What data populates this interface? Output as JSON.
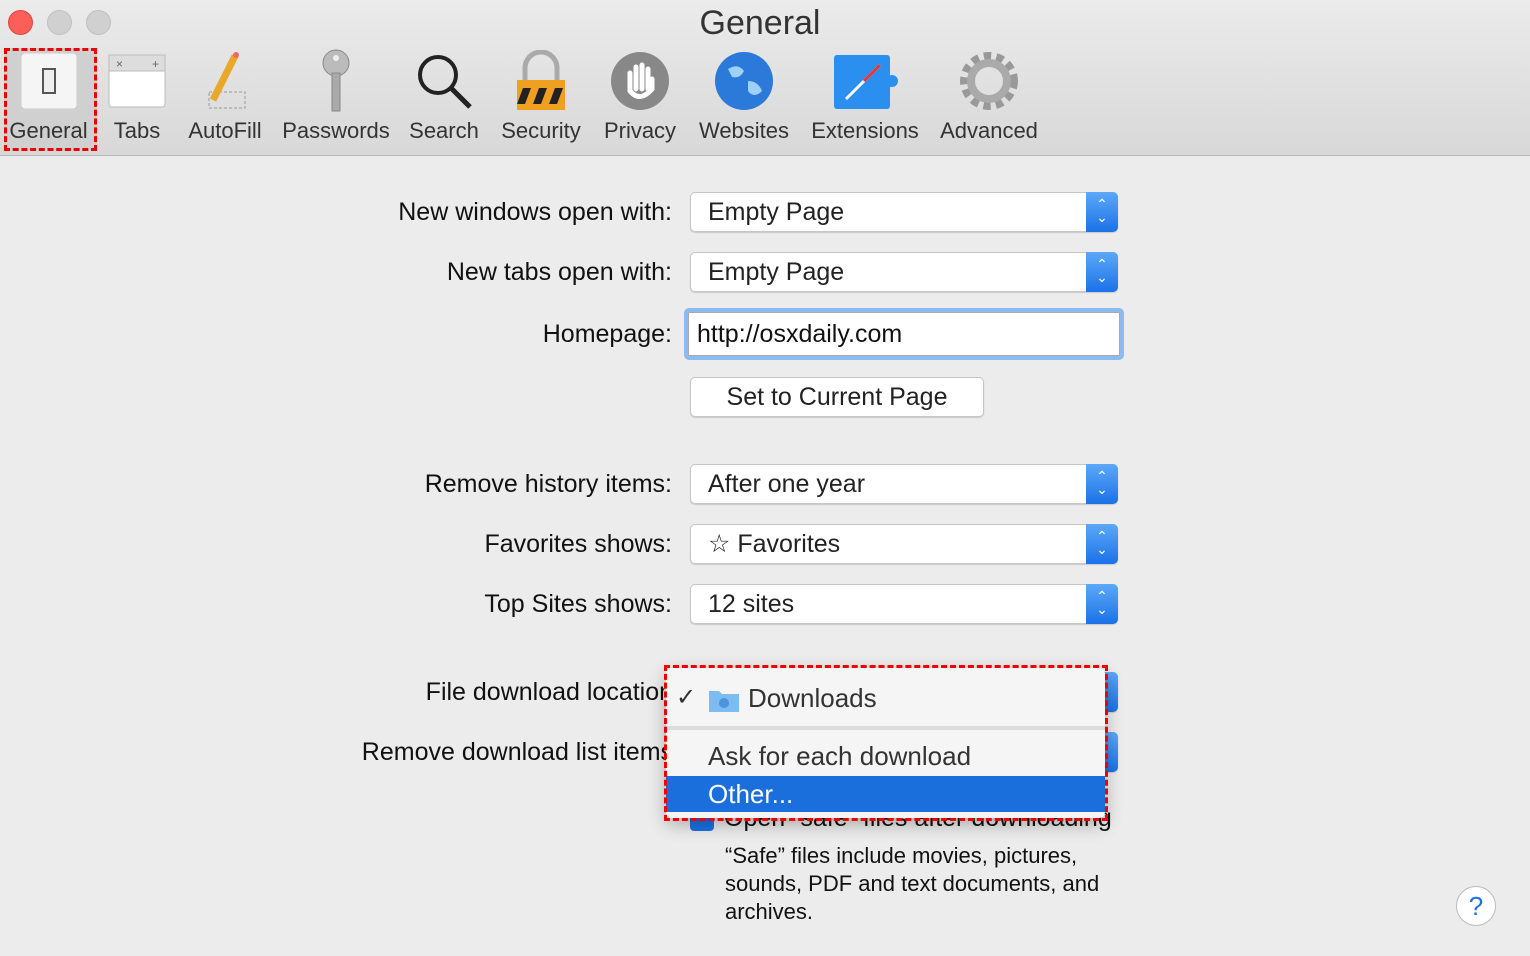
{
  "window": {
    "title": "General"
  },
  "toolbar": {
    "items": [
      {
        "label": "General",
        "icon": "switch-icon"
      },
      {
        "label": "Tabs",
        "icon": "tabs-icon"
      },
      {
        "label": "AutoFill",
        "icon": "pencil-icon"
      },
      {
        "label": "Passwords",
        "icon": "key-icon"
      },
      {
        "label": "Search",
        "icon": "magnifier-icon"
      },
      {
        "label": "Security",
        "icon": "lock-icon"
      },
      {
        "label": "Privacy",
        "icon": "hand-icon"
      },
      {
        "label": "Websites",
        "icon": "globe-icon"
      },
      {
        "label": "Extensions",
        "icon": "puzzle-icon"
      },
      {
        "label": "Advanced",
        "icon": "gear-icon"
      }
    ],
    "selected": "General"
  },
  "form": {
    "new_windows": {
      "label": "New windows open with:",
      "value": "Empty Page"
    },
    "new_tabs": {
      "label": "New tabs open with:",
      "value": "Empty Page"
    },
    "homepage": {
      "label": "Homepage:",
      "value": "http://osxdaily.com"
    },
    "set_current": "Set to Current Page",
    "remove_history": {
      "label": "Remove history items:",
      "value": "After one year"
    },
    "favorites": {
      "label": "Favorites shows:",
      "value": "Favorites"
    },
    "top_sites": {
      "label": "Top Sites shows:",
      "value": "12 sites"
    },
    "download_location": {
      "label": "File download location:"
    },
    "remove_downloads": {
      "label": "Remove download list items:"
    },
    "open_safe": {
      "label": "Open “safe” files after downloading",
      "checked": true
    },
    "safe_note": "“Safe” files include movies, pictures, sounds, PDF and text documents, and archives."
  },
  "menu": {
    "items": [
      {
        "label": "Downloads",
        "checked": true
      },
      {
        "label": "Ask for each download"
      },
      {
        "label": "Other...",
        "highlighted": true
      }
    ]
  },
  "colors": {
    "accent": "#1b72e8",
    "highlight": "#e00000"
  }
}
